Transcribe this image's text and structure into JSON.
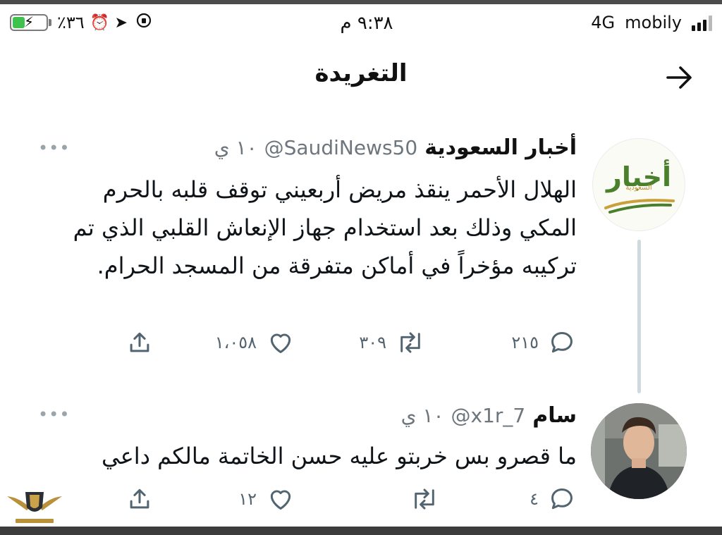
{
  "status_bar": {
    "battery_percent": "٪٣٦",
    "battery_level": 0.36,
    "time": "٩:٣٨ م",
    "network": "4G",
    "carrier": "mobily"
  },
  "header": {
    "title": "التغريدة"
  },
  "tweets": [
    {
      "name": "أخبار السعودية",
      "handle": "@SaudiNews50",
      "time": "١٠ ي",
      "avatar_logo": "أخبار",
      "avatar_logo_sub": "السعودية",
      "text": "الهلال الأحمر ينقذ مريض أربعيني توقف قلبه بالحرم المكي وذلك بعد استخدام جهاز الإنعاش القلبي الذي تم تركيبه مؤخراً في أماكن متفرقة من المسجد الحرام.",
      "replies": "٢١٥",
      "retweets": "٣٠٩",
      "likes": "١،٠٥٨"
    },
    {
      "name": "سام",
      "handle": "@x1r_7",
      "time": "١٠ ي",
      "text": "ما قصرو بس خربتو عليه حسن الخاتمة مالكم داعي",
      "replies": "٤",
      "retweets": "",
      "likes": "١٢"
    }
  ],
  "colors": {
    "text": "#0f1419",
    "muted": "#6e767d",
    "thread_line": "#cfd9de",
    "brand_green": "#4a7f2c"
  }
}
